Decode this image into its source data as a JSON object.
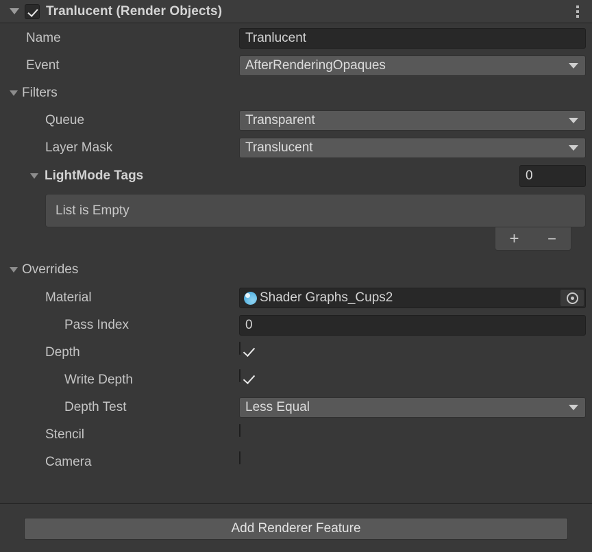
{
  "header": {
    "title": "Tranlucent (Render Objects)",
    "enabled": true,
    "foldout_open": true,
    "menu_icon": "kebab-menu-icon"
  },
  "fields": {
    "name": {
      "label": "Name",
      "value": "Tranlucent"
    },
    "event": {
      "label": "Event",
      "value": "AfterRenderingOpaques"
    }
  },
  "filters": {
    "label": "Filters",
    "queue": {
      "label": "Queue",
      "value": "Transparent"
    },
    "layer_mask": {
      "label": "Layer Mask",
      "value": "Translucent"
    },
    "lightmode_tags": {
      "label": "LightMode Tags",
      "size": "0",
      "empty_text": "List is Empty",
      "add_label": "+",
      "remove_label": "−"
    }
  },
  "overrides": {
    "label": "Overrides",
    "material": {
      "label": "Material",
      "value": "Shader Graphs_Cups2"
    },
    "pass_index": {
      "label": "Pass Index",
      "value": "0"
    },
    "depth": {
      "label": "Depth",
      "checked": true
    },
    "write_depth": {
      "label": "Write Depth",
      "checked": true
    },
    "depth_test": {
      "label": "Depth Test",
      "value": "Less Equal"
    },
    "stencil": {
      "label": "Stencil",
      "checked": false
    },
    "camera": {
      "label": "Camera",
      "checked": false
    }
  },
  "footer": {
    "add_renderer_feature": "Add Renderer Feature"
  },
  "colors": {
    "background": "#383838",
    "header_bg": "#3c3c3c",
    "popup_bg": "#585858",
    "field_bg": "#282828",
    "text": "#c4c4c4",
    "material_icon": "#6ec2ea"
  }
}
